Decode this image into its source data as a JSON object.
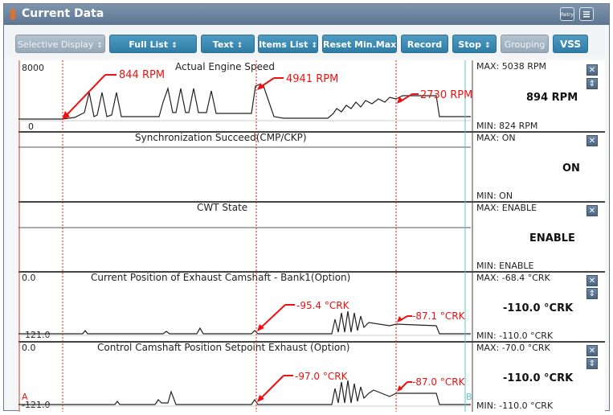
{
  "window": {
    "title": "Current Data",
    "retry_label": "Retry"
  },
  "toolbar": {
    "selective_display": "Selective Display",
    "full_list": "Full List",
    "text": "Text",
    "items_list": "Items List",
    "reset_minmax": "Reset Min.Max",
    "record": "Record",
    "stop": "Stop",
    "grouping": "Grouping",
    "vss": "VSS",
    "spinner_symbol": "↕"
  },
  "colors": {
    "accent": "#2f7da6",
    "annotation": "#ee1111",
    "cursor": "#ee1111",
    "cursor_b": "#5ec4c9",
    "title_bar": "#5c7591"
  },
  "cursors": {
    "a_label": "A",
    "b_label": "B"
  },
  "icons": {
    "close": "close-icon",
    "expand": "expand-icon",
    "retry": "retry-icon",
    "menu": "menu-icon"
  },
  "rows": [
    {
      "title": "Actual Engine Speed",
      "y_top": "8000",
      "y_bottom": "0",
      "max": "MAX:  5038 RPM",
      "current": "894 RPM",
      "min": "MIN:  824 RPM",
      "annotations": [
        "844 RPM",
        "4941 RPM",
        "2730 RPM"
      ]
    },
    {
      "title": "Synchronization Succeed(CMP/CKP)",
      "max": "MAX: ON",
      "current": "ON",
      "min": "MIN: ON"
    },
    {
      "title": "CWT State",
      "max": "MAX: ENABLE",
      "current": "ENABLE",
      "min": "MIN: ENABLE"
    },
    {
      "title": "Current Position of Exhaust Camshaft - Bank1(Option)",
      "y_top": "0.0",
      "y_bottom": "-121.0",
      "max": "MAX:  -68.4 °CRK",
      "current": "-110.0 °CRK",
      "min": "MIN:  -110.0 °CRK",
      "annotations": [
        "-95.4 °CRK",
        "-87.1 °CRK"
      ]
    },
    {
      "title": "Control Camshaft Position Setpoint Exhaust (Option)",
      "y_top": "0.0",
      "y_bottom": "-121.0",
      "max": "MAX:  -70.0 °CRK",
      "current": "-110.0 °CRK",
      "min": "MIN:  -110.0 °CRK",
      "annotations": [
        "-97.0 °CRK",
        "-87.0 °CRK"
      ]
    }
  ]
}
